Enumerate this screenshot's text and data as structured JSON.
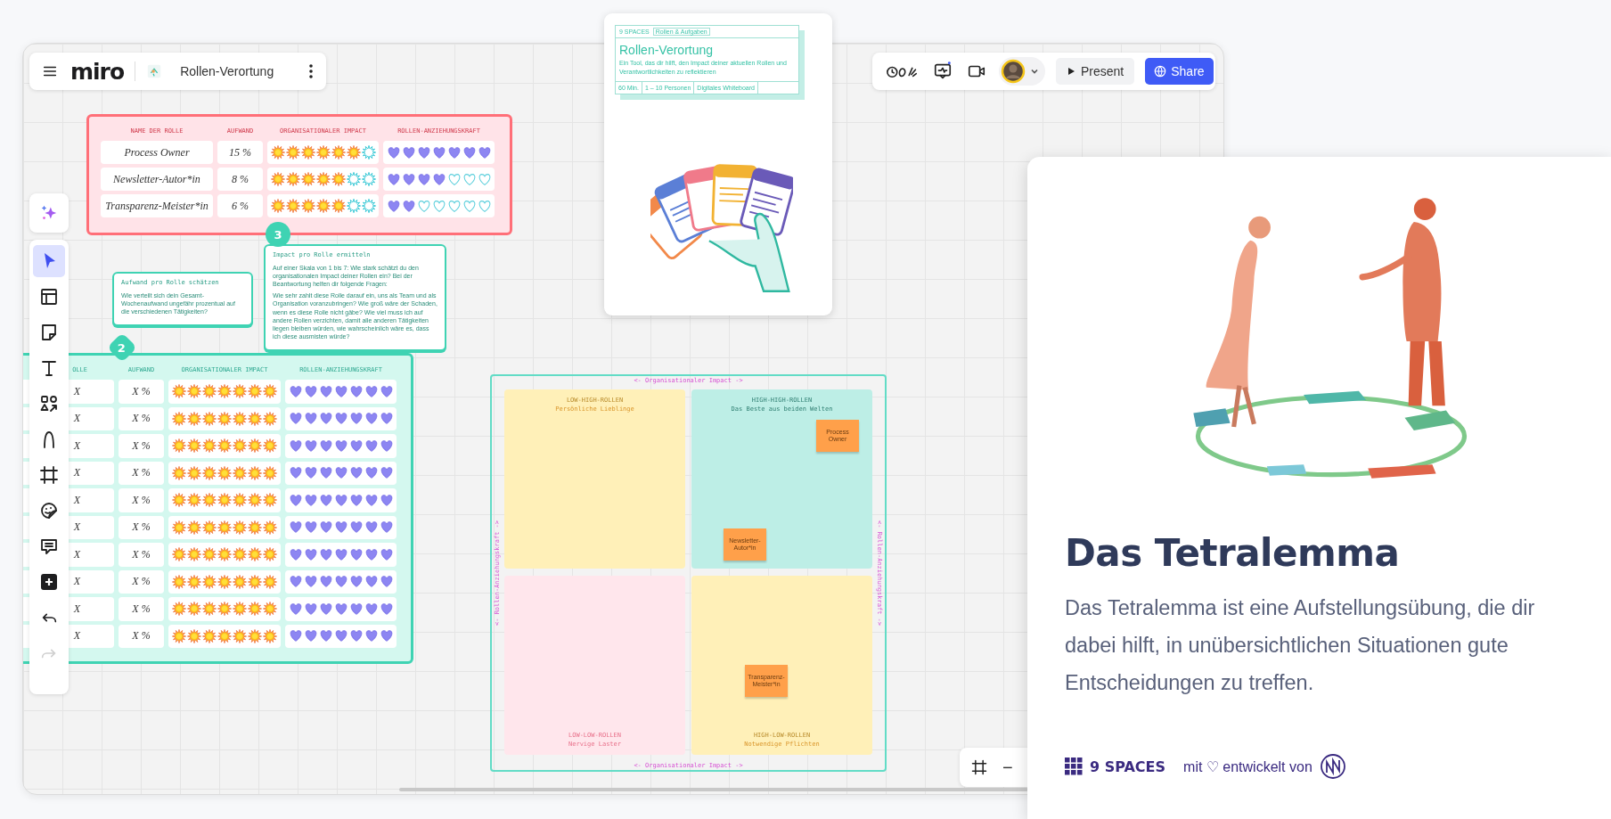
{
  "board_header": {
    "logo": "miro",
    "board_title": "Rollen-Verortung"
  },
  "board_actions": {
    "present": "Present",
    "share": "Share"
  },
  "tools": [
    {
      "kind": "select",
      "selected": true
    },
    {
      "kind": "templates",
      "selected": false
    },
    {
      "kind": "sticky",
      "selected": false
    },
    {
      "kind": "text",
      "selected": false
    },
    {
      "kind": "shapes",
      "selected": false
    },
    {
      "kind": "pen",
      "selected": false
    },
    {
      "kind": "frame",
      "selected": false
    },
    {
      "kind": "stickers",
      "selected": false
    },
    {
      "kind": "comment",
      "selected": false
    },
    {
      "kind": "more",
      "selected": false
    }
  ],
  "history": [
    {
      "kind": "undo",
      "disabled": false
    },
    {
      "kind": "redo",
      "disabled": true
    }
  ],
  "pink_table": {
    "columns": [
      "NAME DER ROLLE",
      "AUFWAND",
      "ORGANISATIONALER IMPACT",
      "ROLLEN-ANZIEHUNGSKRAFT"
    ],
    "rows": [
      {
        "name": "Process Owner",
        "effort": "15 %",
        "impact": {
          "stars": 6
        },
        "attraction": {
          "stars": 7
        }
      },
      {
        "name": "Newsletter-Autor*in",
        "effort": "8 %",
        "impact": {
          "stars": 5
        },
        "attraction": {
          "stars": 4
        }
      },
      {
        "name": "Transparenz-Meister*in",
        "effort": "6 %",
        "impact": {
          "stars": 5
        },
        "attraction": {
          "stars": 2
        }
      }
    ]
  },
  "notes": [
    {
      "title": "Aufwand pro Rolle schätzen",
      "body": [
        "Wie verteilt sich dein Gesamt-Wochenaufwand ungefähr prozentual auf die verschiedenen Tätigkeiten?"
      ]
    },
    {
      "badge": "3",
      "title": "Impact pro Rolle ermitteln",
      "body": [
        "Auf einer Skala von 1 bis 7: Wie stark schätzt du den organisationalen Impact deiner Rollen ein? Bei der Beantwortung helfen dir folgende Fragen:",
        "Wie sehr zahlt diese Rolle darauf ein, uns als Team und als Organisation voranzubringen? Wie groß wäre der Schaden, wenn es diese Rolle nicht gäbe? Wie viel muss ich auf andere Rollen verzichten, damit alle anderen Tätigkeiten liegen bleiben würden, wie wahrscheinlich wäre es, dass ich diese ausmisten würde?"
      ]
    }
  ],
  "green_table": {
    "badge": "2",
    "columns": [
      "OLLE",
      "AUFWAND",
      "ORGANISATIONALER IMPACT",
      "ROLLEN-ANZIEHUNGSKRAFT"
    ],
    "rows": [
      {
        "name": "X",
        "effort": "X %",
        "impact": {
          "stars": 7
        },
        "attraction": {
          "stars": 7
        }
      },
      {
        "name": "X",
        "effort": "X %",
        "impact": {
          "stars": 7
        },
        "attraction": {
          "stars": 7
        }
      },
      {
        "name": "X",
        "effort": "X %",
        "impact": {
          "stars": 7
        },
        "attraction": {
          "stars": 7
        }
      },
      {
        "name": "X",
        "effort": "X %",
        "impact": {
          "stars": 7
        },
        "attraction": {
          "stars": 7
        }
      },
      {
        "name": "X",
        "effort": "X %",
        "impact": {
          "stars": 7
        },
        "attraction": {
          "stars": 7
        }
      },
      {
        "name": "X",
        "effort": "X %",
        "impact": {
          "stars": 7
        },
        "attraction": {
          "stars": 7
        }
      },
      {
        "name": "X",
        "effort": "X %",
        "impact": {
          "stars": 7
        },
        "attraction": {
          "stars": 7
        }
      },
      {
        "name": "X",
        "effort": "X %",
        "impact": {
          "stars": 7
        },
        "attraction": {
          "stars": 7
        }
      },
      {
        "name": "X",
        "effort": "X %",
        "impact": {
          "stars": 7
        },
        "attraction": {
          "stars": 7
        }
      },
      {
        "name": "X",
        "effort": "X %",
        "impact": {
          "stars": 7
        },
        "attraction": {
          "stars": 7
        }
      }
    ]
  },
  "matrix": {
    "axis_top": "<- Organisationaler Impact ->",
    "axis_bottom": "<- Organisationaler Impact ->",
    "axis_left": "<- Rollen-Anziehungskraft ->",
    "axis_right": "<- Rollen-Anziehungskraft ->",
    "quadrants": [
      {
        "label": "LOW-HIGH-ROLLEN",
        "title": "Persönliche Lieblinge",
        "color": "#fff0b8"
      },
      {
        "label": "HIGH-HIGH-ROLLEN",
        "title": "Das Beste aus beiden Welten",
        "color": "#bdeee6",
        "notes": [
          "Process Owner",
          "Newsletter-Autor*in"
        ]
      },
      {
        "label": "LOW-LOW-ROLLEN",
        "title": "Nervige Laster",
        "color": "#ffe6ec"
      },
      {
        "label": "HIGH-LOW-ROLLEN",
        "title": "Notwendige Pflichten",
        "color": "#fff0b8",
        "notes": [
          "Transparenz-Meister*in"
        ]
      }
    ]
  },
  "zoom_controls": {
    "zoom_out": "−"
  },
  "board_card": {
    "brand": "9 SPACES",
    "tag": "Rollen & Aufgaben",
    "title": "Rollen-Verortung",
    "description": "Ein Tool, das dir hilft, den Impact deiner aktuellen Rollen und Verantwortlichkeiten zu reflektieren",
    "meta": [
      "60 Min.",
      "1 – 10 Personen",
      "Digitales Whiteboard"
    ]
  },
  "feature_card": {
    "title": "Das Tetralemma",
    "description": "Das Tetralemma ist eine Aufstellungsübung, die dir dabei hilft, in unübersichtlichen Situationen gute Entscheidungen zu treffen.",
    "brand": "9 SPACES",
    "credit": "mit ♡ entwickelt von"
  }
}
